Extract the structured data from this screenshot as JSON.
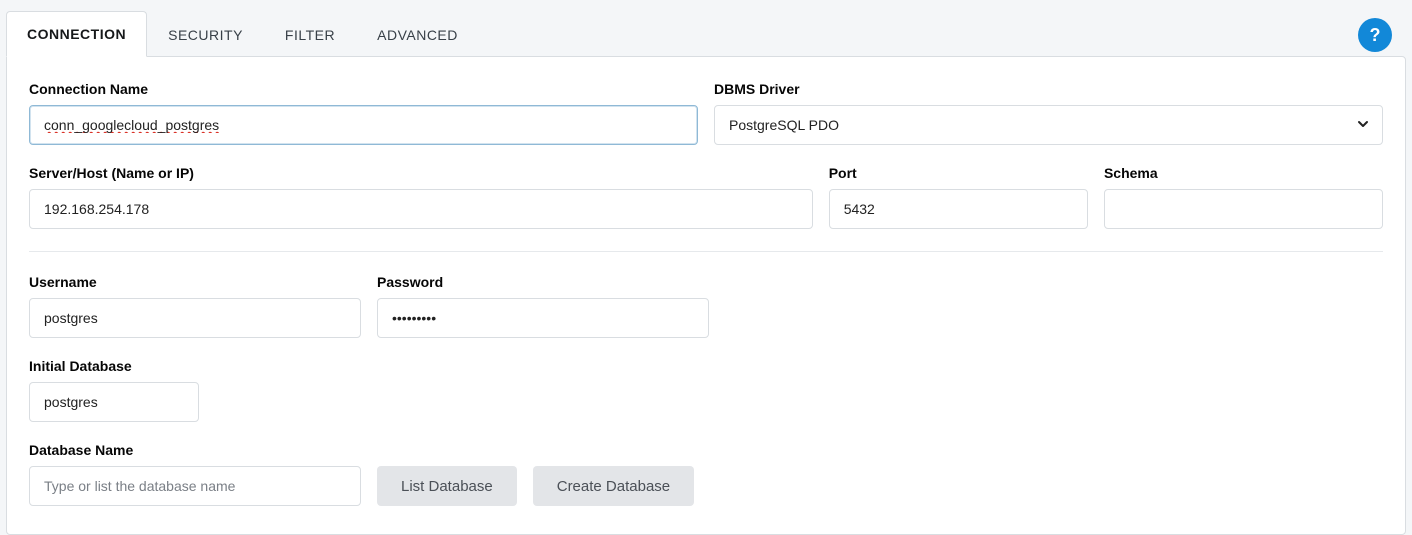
{
  "tabs": {
    "connection": "CONNECTION",
    "security": "SECURITY",
    "filter": "FILTER",
    "advanced": "ADVANCED"
  },
  "help": {
    "glyph": "?"
  },
  "connection": {
    "name_label": "Connection Name",
    "name_value": "conn_googlecloud_postgres",
    "driver_label": "DBMS Driver",
    "driver_value": "PostgreSQL PDO"
  },
  "server": {
    "host_label": "Server/Host (Name or IP)",
    "host_value": "192.168.254.178",
    "port_label": "Port",
    "port_value": "5432",
    "schema_label": "Schema",
    "schema_value": ""
  },
  "auth": {
    "user_label": "Username",
    "user_value": "postgres",
    "pass_label": "Password",
    "pass_value": "•••••••••"
  },
  "db": {
    "init_label": "Initial Database",
    "init_value": "postgres",
    "name_label": "Database Name",
    "name_placeholder": "Type or list the database name",
    "list_btn": "List Database",
    "create_btn": "Create Database"
  }
}
